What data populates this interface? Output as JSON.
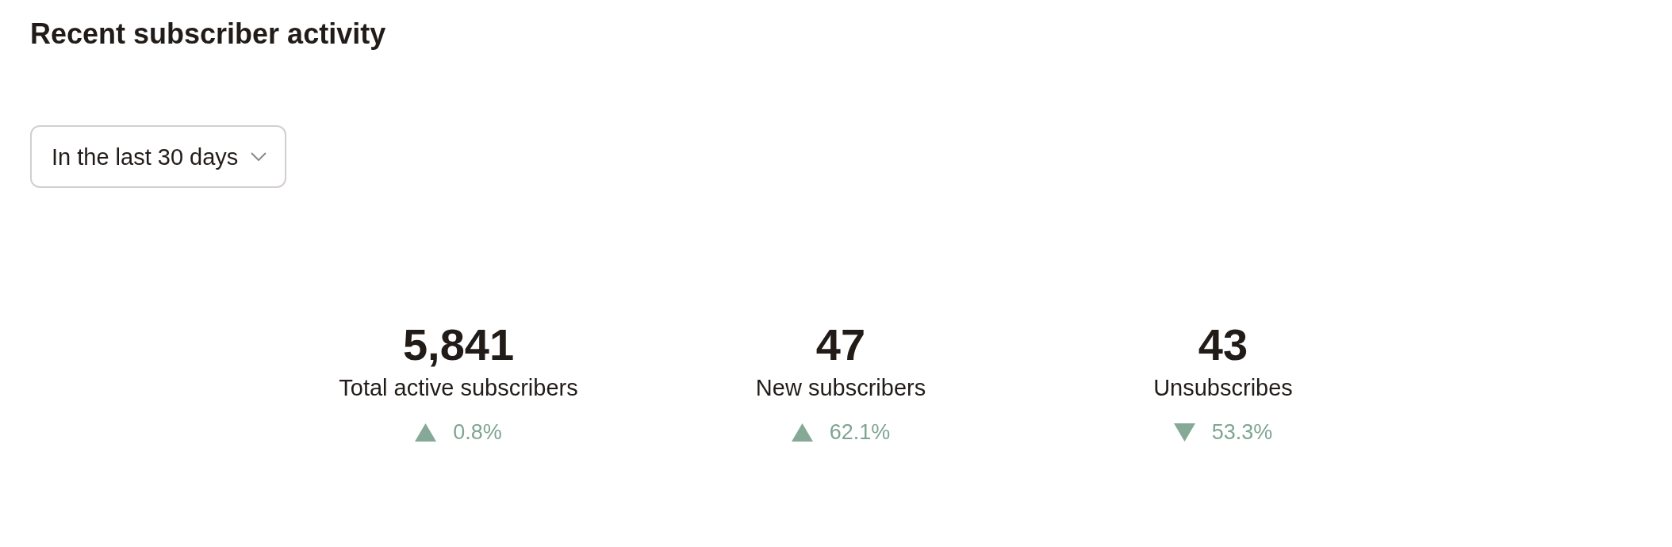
{
  "section": {
    "title": "Recent subscriber activity"
  },
  "filter": {
    "value": "In the last 30 days"
  },
  "stats": [
    {
      "value": "5,841",
      "label": "Total active subscribers",
      "increase": true,
      "change": "0.8%"
    },
    {
      "value": "47",
      "label": "New subscribers",
      "increase": true,
      "change": "62.1%"
    },
    {
      "value": "43",
      "label": "Unsubscribes",
      "increase": false,
      "change": "53.3%"
    }
  ]
}
